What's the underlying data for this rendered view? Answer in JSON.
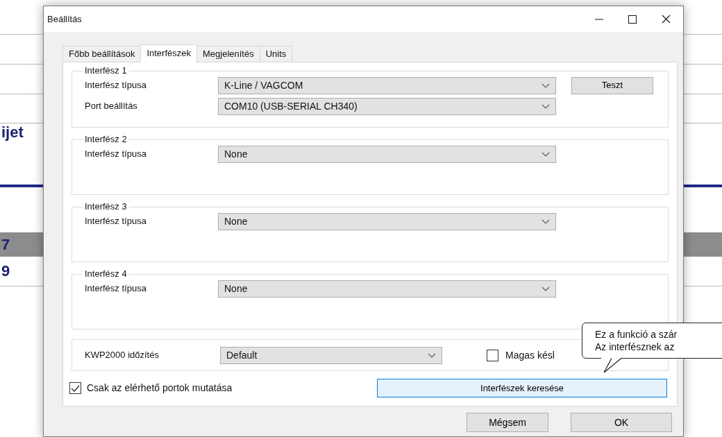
{
  "background_page": {
    "heading_fragment": "ijet",
    "row_numbers": [
      "7",
      "9"
    ]
  },
  "window": {
    "title": "Beállítás"
  },
  "tabs": [
    {
      "label": "Főbb beállítások",
      "selected": false
    },
    {
      "label": "Interfészek",
      "selected": true
    },
    {
      "label": "Megjelenítés",
      "selected": false
    },
    {
      "label": "Units",
      "selected": false
    }
  ],
  "interface_groups": [
    {
      "title": "Interfész 1",
      "rows": [
        {
          "label": "Interfész típusa",
          "value": "K-Line / VAGCOM"
        },
        {
          "label": "Port beállítás",
          "value": "COM10  (USB-SERIAL CH340)"
        }
      ],
      "button": "Teszt"
    },
    {
      "title": "Interfész 2",
      "rows": [
        {
          "label": "Interfész típusa",
          "value": "None"
        }
      ]
    },
    {
      "title": "Interfész 3",
      "rows": [
        {
          "label": "Interfész típusa",
          "value": "None"
        }
      ]
    },
    {
      "title": "Interfész 4",
      "rows": [
        {
          "label": "Interfész típusa",
          "value": "None"
        }
      ]
    }
  ],
  "timing": {
    "label": "KWP2000 időzítés",
    "value": "Default",
    "high_latency": {
      "label": "Magas késl",
      "checked": false
    }
  },
  "show_available_ports": {
    "label": "Csak az elérhető portok mutatása",
    "checked": true
  },
  "search_button": {
    "label": "Interfészek keresése"
  },
  "buttons": [
    "Mégsem",
    "OK"
  ],
  "tooltip": {
    "lines": [
      "Ez a funkció a szár",
      "Az interfésznek az"
    ]
  }
}
